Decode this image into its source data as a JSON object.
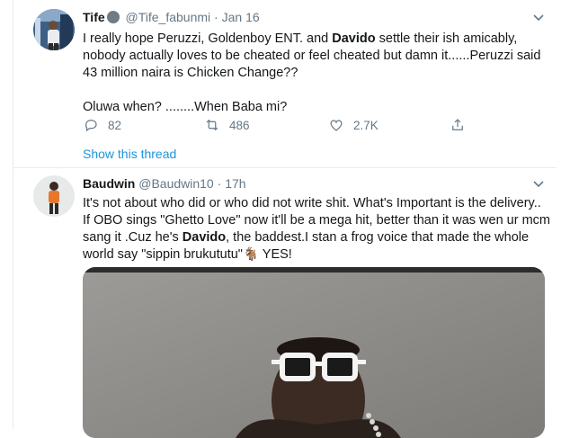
{
  "tweets": [
    {
      "name": "Tife",
      "handle": "@Tife_fabunmi",
      "sep": "·",
      "time": "Jan 16",
      "text_p1_a": "I really hope Peruzzi, Goldenboy ENT. and ",
      "text_p1_bold": "Davido",
      "text_p1_b": " settle their ish amicably, nobody actually loves to be cheated or feel cheated but damn it......Peruzzi said 43 million naira is Chicken Change??",
      "text_p2": "Oluwa when? ........When Baba mi?",
      "replies": "82",
      "retweets": "486",
      "likes": "2.7K",
      "show_thread": "Show this thread"
    },
    {
      "name": "Baudwin",
      "handle": "@Baudwin10",
      "sep": "·",
      "time": "17h",
      "text_a": "It's not about who did or who did not write shit. What's Important is the delivery.. If OBO sings \"Ghetto Love\" now it'll be a mega hit, better than it was wen ur mcm sang it .Cuz he's ",
      "text_bold": "Davido",
      "text_b": ", the baddest.I stan a frog voice that made the whole world say \"sippin brukututu\"",
      "emoji": "🐐",
      "text_c": " YES!"
    }
  ],
  "icons": [
    "verified-face-emoji",
    "chevron-down-icon",
    "reply-icon",
    "retweet-icon",
    "like-icon",
    "share-icon"
  ],
  "colors": {
    "link": "#1b95e0",
    "muted": "#657786",
    "text": "#14171a",
    "divider": "#e6ecf0"
  }
}
